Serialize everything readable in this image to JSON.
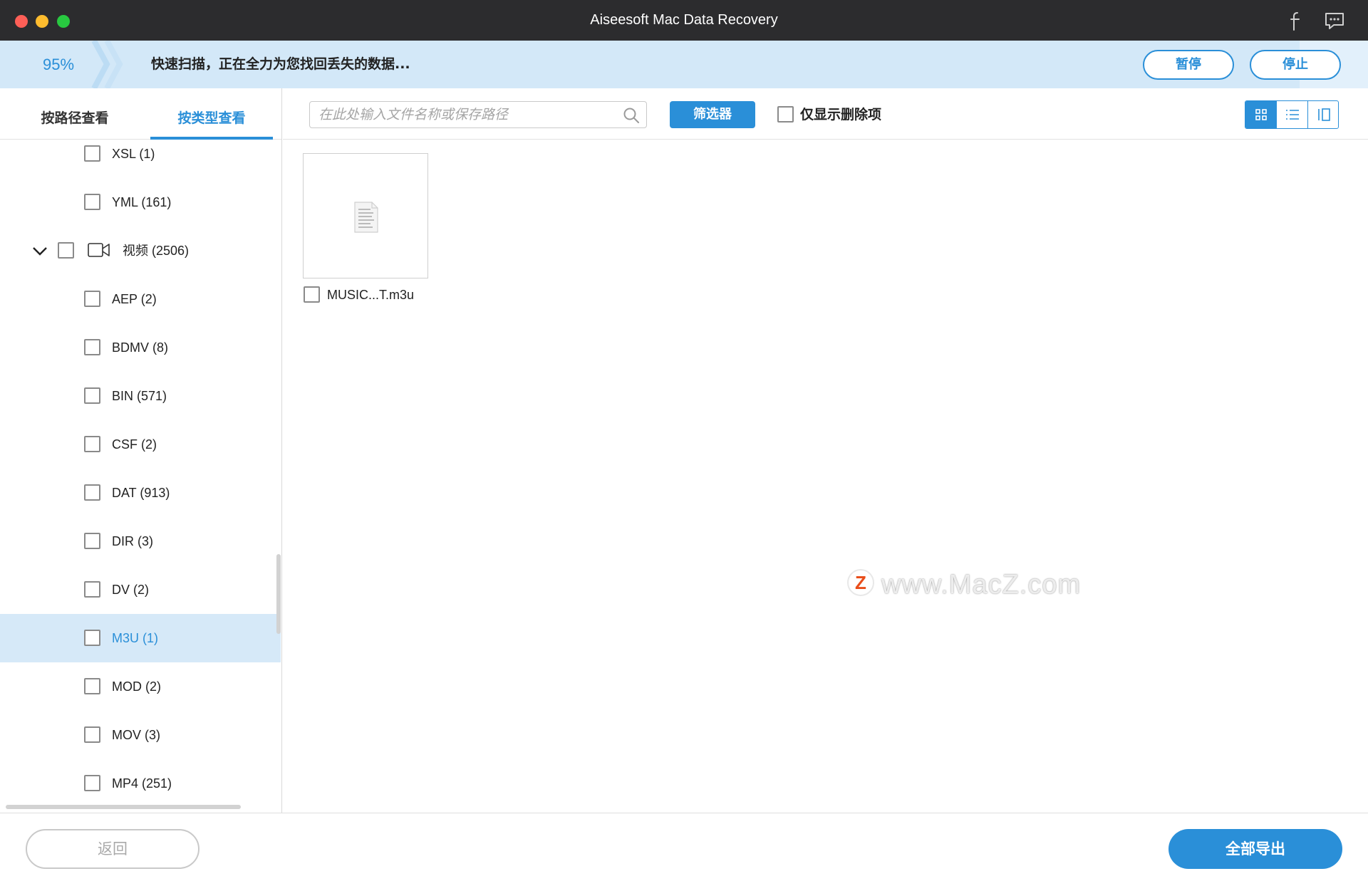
{
  "window": {
    "title": "Aiseesoft Mac Data Recovery"
  },
  "scan": {
    "percent_label": "95%",
    "progress": 0.95,
    "message": "快速扫描，正在全力为您找回丢失的数据...",
    "pause_label": "暂停",
    "stop_label": "停止"
  },
  "sidebar": {
    "tabs": [
      {
        "label": "按路径查看",
        "active": false
      },
      {
        "label": "按类型查看",
        "active": true
      }
    ],
    "items": [
      {
        "label": "XSL (1)",
        "level": 1,
        "selected": false
      },
      {
        "label": "YML (161)",
        "level": 1,
        "selected": false
      },
      {
        "label": "视频 (2506)",
        "level": 0,
        "expanded": true,
        "icon": "video-camera-icon",
        "selected": false
      },
      {
        "label": "AEP (2)",
        "level": 1,
        "selected": false
      },
      {
        "label": "BDMV (8)",
        "level": 1,
        "selected": false
      },
      {
        "label": "BIN (571)",
        "level": 1,
        "selected": false
      },
      {
        "label": "CSF (2)",
        "level": 1,
        "selected": false
      },
      {
        "label": "DAT (913)",
        "level": 1,
        "selected": false
      },
      {
        "label": "DIR (3)",
        "level": 1,
        "selected": false
      },
      {
        "label": "DV (2)",
        "level": 1,
        "selected": false
      },
      {
        "label": "M3U (1)",
        "level": 1,
        "selected": true
      },
      {
        "label": "MOD (2)",
        "level": 1,
        "selected": false
      },
      {
        "label": "MOV (3)",
        "level": 1,
        "selected": false
      },
      {
        "label": "MP4 (251)",
        "level": 1,
        "selected": false
      }
    ]
  },
  "toolbar": {
    "search_placeholder": "在此处输入文件名称或保存路径",
    "filter_label": "筛选器",
    "deleted_only_label": "仅显示删除项",
    "views": [
      "grid-view-icon",
      "list-view-icon",
      "detail-view-icon"
    ],
    "active_view": "grid-view-icon"
  },
  "files": [
    {
      "name": "MUSIC...T.m3u",
      "icon": "document-thumbnail-icon"
    }
  ],
  "watermark": {
    "logo": "Z",
    "text": "www.MacZ.com"
  },
  "footer": {
    "back_label": "返回",
    "export_label": "全部导出"
  },
  "colors": {
    "accent": "#2a8fd8",
    "titlebar": "#2c2c2e",
    "progress_bg": "#e2f0fb",
    "selected_row": "#d6e9f8"
  }
}
